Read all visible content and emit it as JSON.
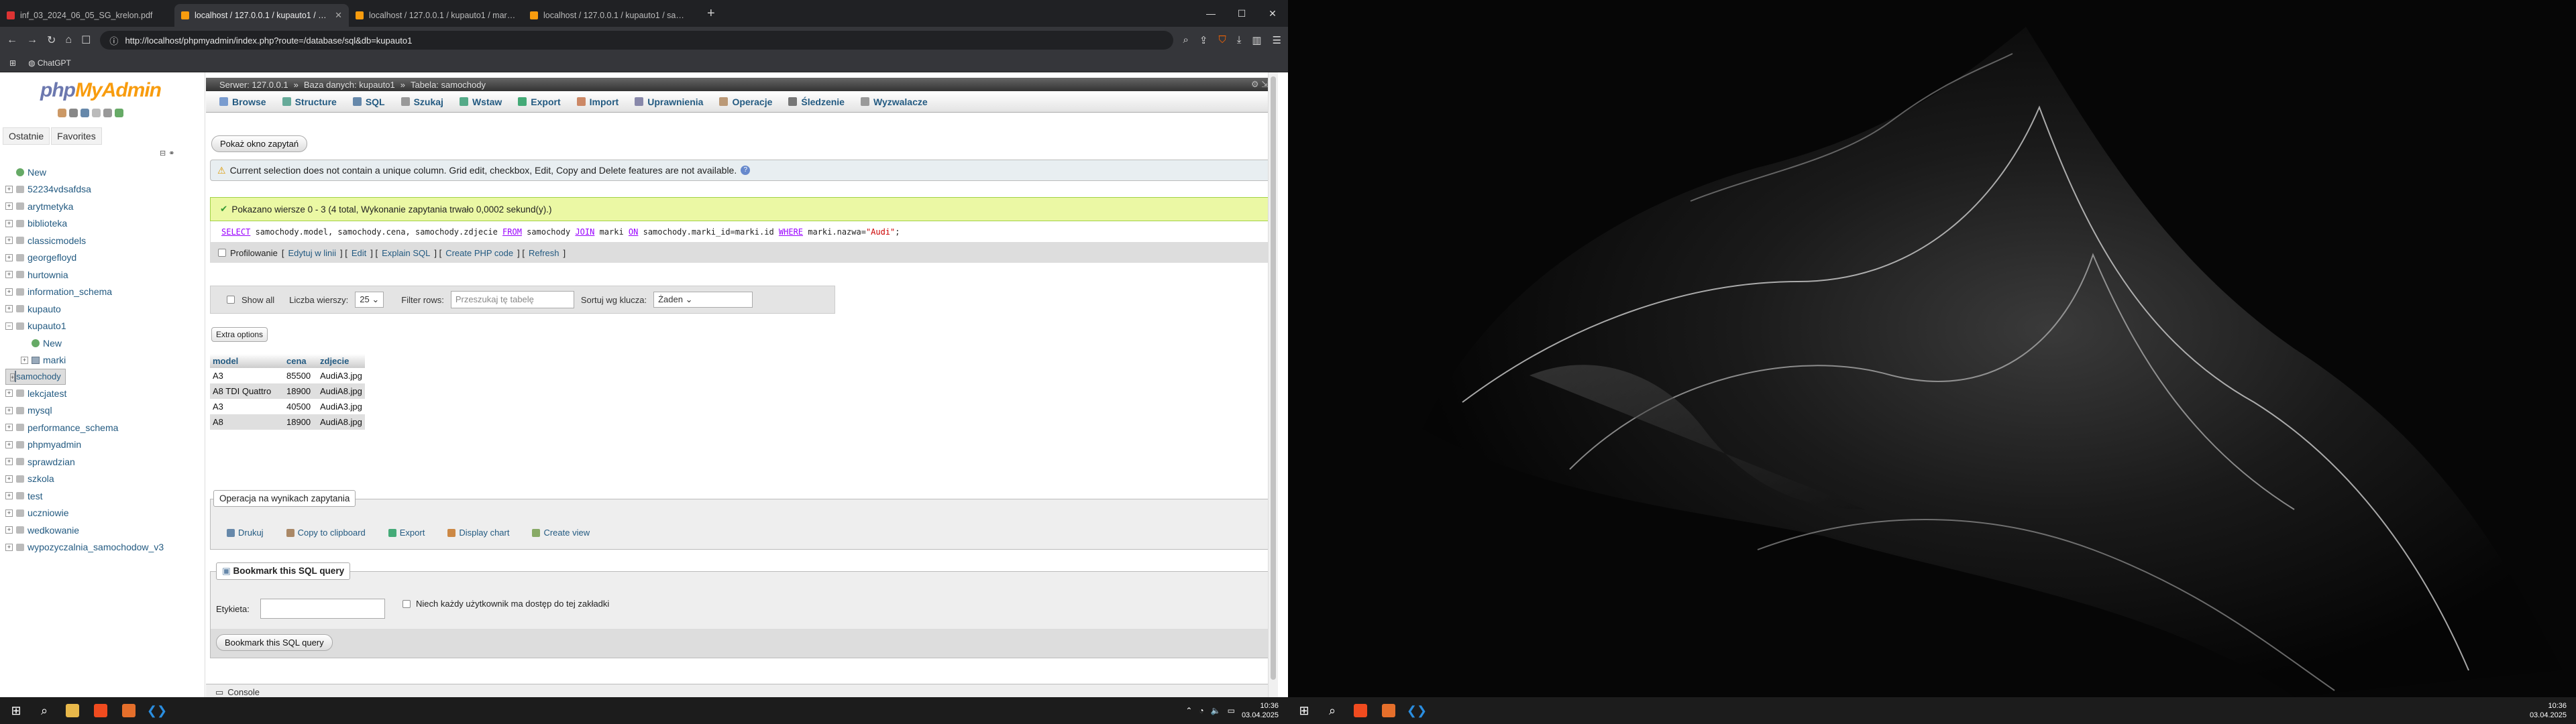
{
  "browser": {
    "tabs": [
      {
        "title": "inf_03_2024_06_05_SG_krelon.pdf",
        "color": "#d33"
      },
      {
        "title": "localhost / 127.0.0.1 / kupauto1 / samochody | phpMyAdmin",
        "color": "#f89c0e"
      },
      {
        "title": "localhost / 127.0.0.1 / kupauto1 / marki | phpMyAdmin",
        "color": "#f89c0e"
      },
      {
        "title": "localhost / 127.0.0.1 / kupauto1 / samochody | phpMyAdmin",
        "color": "#f89c0e"
      }
    ],
    "url": "http://localhost/phpmyadmin/index.php?route=/database/sql&db=kupauto1",
    "bookmarks": [
      "ChatGPT"
    ]
  },
  "pma": {
    "logo_main": "php",
    "logo_accent": "MyAdmin",
    "left_tabs": [
      "Ostatnie",
      "Favorites"
    ],
    "tree": [
      {
        "label": "New",
        "type": "new",
        "level": 0
      },
      {
        "label": "52234vdsafdsa",
        "type": "db",
        "level": 0
      },
      {
        "label": "arytmetyka",
        "type": "db",
        "level": 0
      },
      {
        "label": "biblioteka",
        "type": "db",
        "level": 0
      },
      {
        "label": "classicmodels",
        "type": "db",
        "level": 0
      },
      {
        "label": "georgefloyd",
        "type": "db",
        "level": 0
      },
      {
        "label": "hurtownia",
        "type": "db",
        "level": 0
      },
      {
        "label": "information_schema",
        "type": "db",
        "level": 0
      },
      {
        "label": "kupauto",
        "type": "db",
        "level": 0
      },
      {
        "label": "kupauto1",
        "type": "db",
        "level": 0,
        "open": true
      },
      {
        "label": "New",
        "type": "new",
        "level": 1
      },
      {
        "label": "marki",
        "type": "tb",
        "level": 1
      },
      {
        "label": "samochody",
        "type": "tb",
        "level": 1,
        "selected": true
      },
      {
        "label": "lekcjatest",
        "type": "db",
        "level": 0
      },
      {
        "label": "mysql",
        "type": "db",
        "level": 0
      },
      {
        "label": "performance_schema",
        "type": "db",
        "level": 0
      },
      {
        "label": "phpmyadmin",
        "type": "db",
        "level": 0
      },
      {
        "label": "sprawdzian",
        "type": "db",
        "level": 0
      },
      {
        "label": "szkola",
        "type": "db",
        "level": 0
      },
      {
        "label": "test",
        "type": "db",
        "level": 0
      },
      {
        "label": "uczniowie",
        "type": "db",
        "level": 0
      },
      {
        "label": "wedkowanie",
        "type": "db",
        "level": 0
      },
      {
        "label": "wypozyczalnia_samochodow_v3",
        "type": "db",
        "level": 0
      }
    ],
    "breadcrumb": {
      "server": "Serwer: 127.0.0.1",
      "database": "Baza danych: kupauto1",
      "table": "Tabela: samochody"
    },
    "menu": [
      {
        "label": "Browse",
        "color": "#7a9ccf"
      },
      {
        "label": "Structure",
        "color": "#6a9"
      },
      {
        "label": "SQL",
        "color": "#68a"
      },
      {
        "label": "Szukaj",
        "color": "#999"
      },
      {
        "label": "Wstaw",
        "color": "#5a8"
      },
      {
        "label": "Export",
        "color": "#4a7"
      },
      {
        "label": "Import",
        "color": "#c86"
      },
      {
        "label": "Uprawnienia",
        "color": "#88a"
      },
      {
        "label": "Operacje",
        "color": "#b97"
      },
      {
        "label": "Śledzenie",
        "color": "#777"
      },
      {
        "label": "Wyzwalacze",
        "color": "#999"
      }
    ],
    "show_query_btn": "Pokaż okno zapytań",
    "notice": "Current selection does not contain a unique column. Grid edit, checkbox, Edit, Copy and Delete features are not available.",
    "success": "Pokazano wiersze 0 - 3 (4 total, Wykonanie zapytania trwało 0,0002 sekund(y).)",
    "sql": {
      "select": "SELECT",
      "cols": " samochody.model, samochody.cena, samochody.zdjecie ",
      "from": "FROM",
      "t1": " samochody ",
      "join": "JOIN",
      "t2": " marki ",
      "on": "ON",
      "cond": " samochody.marki_id=marki.id ",
      "where": "WHERE",
      "cond2": " marki.nazwa=",
      "val": "\"Audi\"",
      "end": ";"
    },
    "sql_links": {
      "profiling": "Profilowanie",
      "edit_inline": "Edytuj w linii",
      "edit": "Edit",
      "explain": "Explain SQL",
      "php": "Create PHP code",
      "refresh": "Refresh"
    },
    "nav": {
      "show_all": "Show all",
      "rows_label": "Liczba wierszy:",
      "rows_value": "25",
      "filter_label": "Filter rows:",
      "filter_placeholder": "Przeszukaj tę tabelę",
      "sort_label": "Sortuj wg klucza:",
      "sort_value": "Żaden"
    },
    "extra_options": "Extra options",
    "table": {
      "headers": [
        "model",
        "cena",
        "zdjecie"
      ],
      "rows": [
        [
          "A3",
          "85500",
          "AudiA3.jpg"
        ],
        [
          "A8 TDI Quattro",
          "18900",
          "AudiA8.jpg"
        ],
        [
          "A3",
          "40500",
          "AudiA3.jpg"
        ],
        [
          "A8",
          "18900",
          "AudiA8.jpg"
        ]
      ]
    },
    "ops": {
      "legend": "Operacja na wynikach zapytania",
      "items": [
        {
          "label": "Drukuj",
          "color": "#68a"
        },
        {
          "label": "Copy to clipboard",
          "color": "#a86"
        },
        {
          "label": "Export",
          "color": "#4a7"
        },
        {
          "label": "Display chart",
          "color": "#c84"
        },
        {
          "label": "Create view",
          "color": "#8a6"
        }
      ]
    },
    "bookmark": {
      "legend": "Bookmark this SQL query",
      "label": "Etykieta:",
      "shared": "Niech każdy użytkownik ma dostęp do tej zakładki",
      "button": "Bookmark this SQL query"
    },
    "console": "Console"
  },
  "taskbar": {
    "time": "10:36",
    "date": "03.04.2025"
  }
}
